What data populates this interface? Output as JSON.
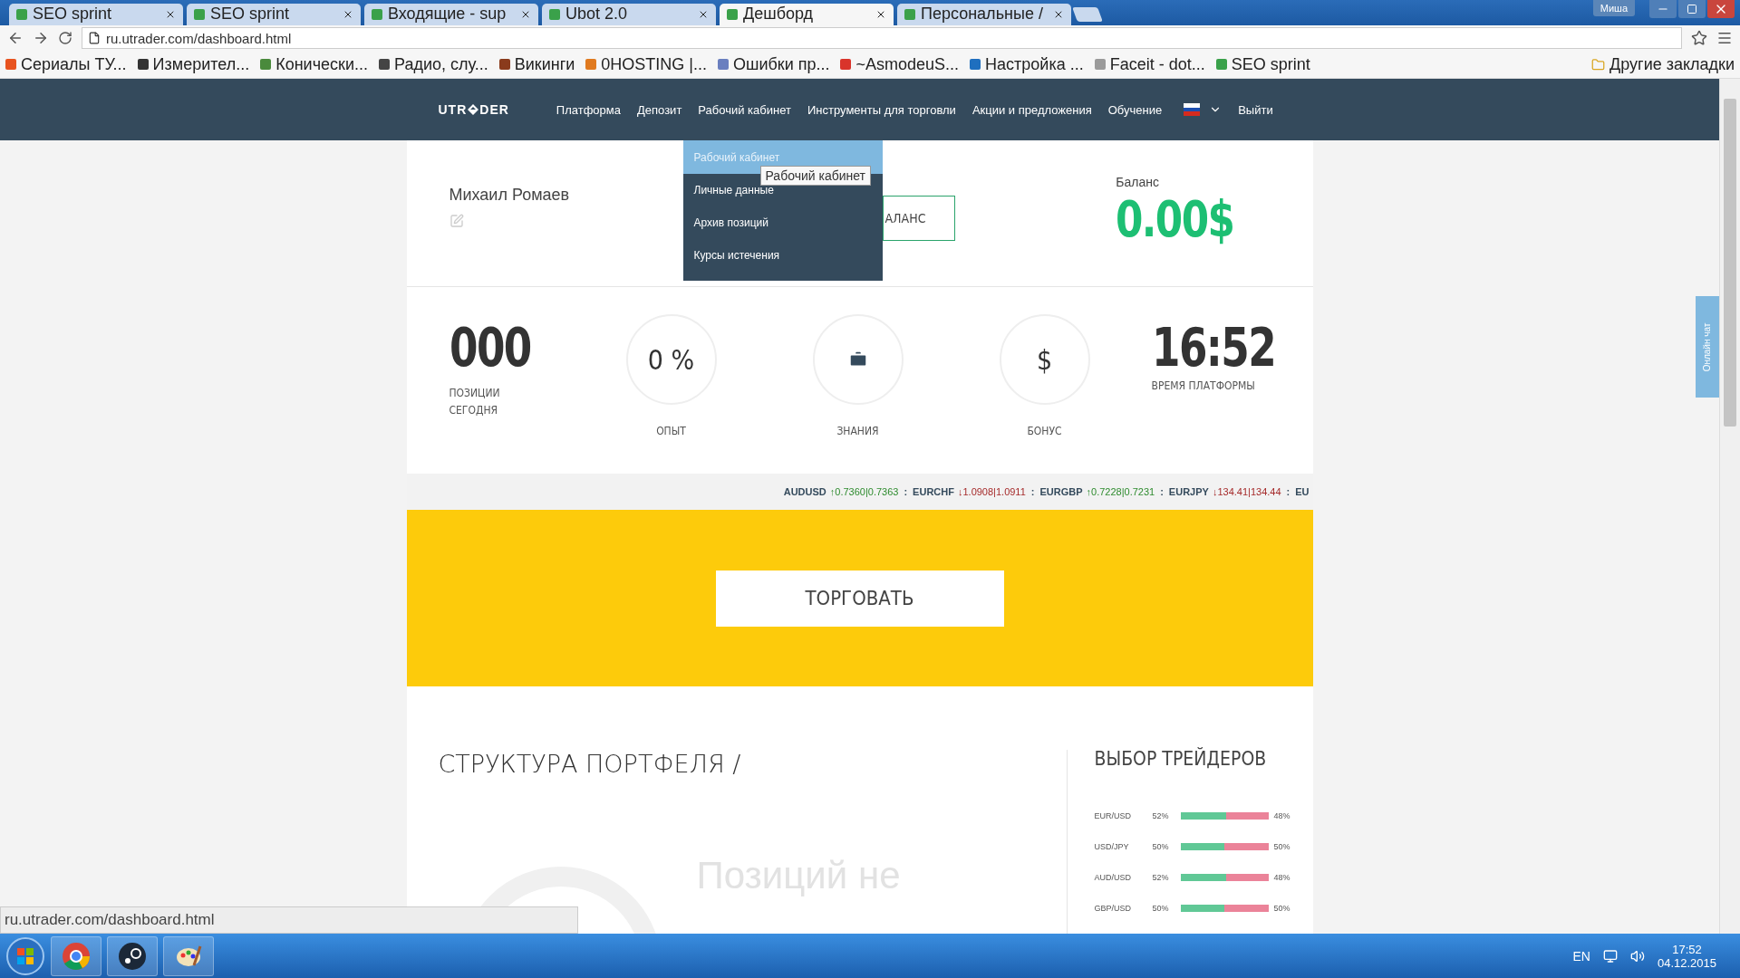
{
  "browser": {
    "tabs": [
      {
        "title": "SEO sprint",
        "selected": false
      },
      {
        "title": "SEO sprint",
        "selected": false
      },
      {
        "title": "Входящие - sup",
        "selected": false
      },
      {
        "title": "Ubot 2.0",
        "selected": false
      },
      {
        "title": "Дешборд",
        "selected": true
      },
      {
        "title": "Персональные /",
        "selected": false
      }
    ],
    "profile": "Миша",
    "address": "ru.utrader.com/dashboard.html",
    "bookmarks": [
      {
        "label": "Сериалы ТУ...",
        "color": "#e8531f"
      },
      {
        "label": "Измерител...",
        "color": "#333333"
      },
      {
        "label": "Конически...",
        "color": "#4a8a3c"
      },
      {
        "label": "Радио, слу...",
        "color": "#444444"
      },
      {
        "label": "Викинги",
        "color": "#8a3b1c"
      },
      {
        "label": "0HOSTING |...",
        "color": "#e07a1f"
      },
      {
        "label": "Ошибки пр...",
        "color": "#6a7fbf"
      },
      {
        "label": "~AsmodeuS...",
        "color": "#d9342b"
      },
      {
        "label": "Настройка ...",
        "color": "#1f6fbf"
      },
      {
        "label": "Faceit - dot...",
        "color": "#9a9a9a"
      },
      {
        "label": "SEO sprint",
        "color": "#3aa14a"
      }
    ],
    "other_bookmarks": "Другие закладки",
    "status_url": "ru.utrader.com/dashboard.html"
  },
  "site": {
    "logo_left": "UTR",
    "logo_right": "DER",
    "nav": [
      "Платформа",
      "Депозит",
      "Рабочий кабинет",
      "Инструменты для торговли",
      "Акции и предложения",
      "Обучение"
    ],
    "logout": "Выйти",
    "dropdown": [
      {
        "label": "Рабочий кабинет",
        "selected": true
      },
      {
        "label": "Личные данные",
        "selected": false
      },
      {
        "label": "Архив позиций",
        "selected": false
      },
      {
        "label": "Курсы истечения",
        "selected": false
      }
    ],
    "tooltip": "Рабочий кабинет",
    "user_name": "Михаил Ромаев",
    "balance_button": "АЛАНС",
    "balance_label": "Баланс",
    "balance": "0.00$",
    "positions": "000",
    "positions_label": [
      "ПОЗИЦИИ",
      "СЕГОДНЯ"
    ],
    "circles": [
      {
        "kind": "text",
        "value": "0 %",
        "label": "ОПЫТ"
      },
      {
        "kind": "briefcase",
        "label": "ЗНАНИЯ"
      },
      {
        "kind": "text",
        "value": "$",
        "label": "БОНУС"
      }
    ],
    "time": "16:52",
    "time_label": "ВРЕМЯ ПЛАТФОРМЫ",
    "ticker": [
      {
        "pair": "AUDUSD",
        "quote": "↑0.7360|0.7363",
        "color": "#2e8b2e"
      },
      {
        "pair": "EURCHF",
        "quote": "↓1.0908|1.0911",
        "color": "#a52a2a"
      },
      {
        "pair": "EURGBP",
        "quote": "↑0.7228|0.7231",
        "color": "#2e8b2e"
      },
      {
        "pair": "EURJPY",
        "quote": "↓134.41|134.44",
        "color": "#a52a2a"
      },
      {
        "pair": "EU"
      }
    ],
    "ticker_separator": ":",
    "trade_button": "ТОРГОВАТЬ",
    "portfolio_title": "СТРУКТУРА ПОРТФЕЛЯ /",
    "portfolio_empty": "Позиций не",
    "traders_title": "ВЫБОР ТРЕЙДЕРОВ",
    "traders": [
      {
        "pair": "EUR/USD",
        "buy": "52%",
        "sell": "48%",
        "level": 0.52
      },
      {
        "pair": "USD/JPY",
        "buy": "50%",
        "sell": "50%",
        "level": 0.5
      },
      {
        "pair": "AUD/USD",
        "buy": "52%",
        "sell": "48%",
        "level": 0.52
      },
      {
        "pair": "GBP/USD",
        "buy": "50%",
        "sell": "50%",
        "level": 0.5
      }
    ],
    "chat": "Онлайн чат"
  },
  "taskbar": {
    "language": "EN",
    "time": "17:52",
    "date": "04.12.2015"
  }
}
